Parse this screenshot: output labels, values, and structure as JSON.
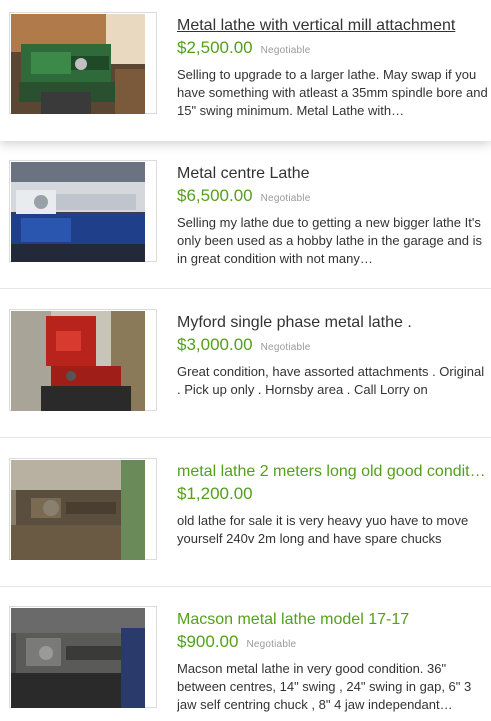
{
  "listings": [
    {
      "title": "Metal lathe with vertical mill attachment",
      "price": "$2,500.00",
      "negotiable": "Negotiable",
      "description": "Selling to upgrade to a larger lathe. May swap if you have something with atleast a 35mm spindle bore and 15\" swing minimum. Metal Lathe with…",
      "image_icon": "green-lathe-photo"
    },
    {
      "title": "Metal centre Lathe",
      "price": "$6,500.00",
      "negotiable": "Negotiable",
      "description": "Selling my lathe due to getting a new bigger lathe It's only been used as a hobby lathe in the garage and is in great condition with not many…",
      "image_icon": "blue-lathe-photo"
    },
    {
      "title": "Myford single phase metal lathe .",
      "price": "$3,000.00",
      "negotiable": "Negotiable",
      "description": "Great condition, have assorted attachments . Original . Pick up only . Hornsby area . Call Lorry on",
      "image_icon": "red-lathe-photo"
    },
    {
      "title": "metal lathe 2 meters long old good conditi…",
      "price": "$1,200.00",
      "negotiable": "",
      "description": "old lathe for sale it is very heavy yuo have to move yourself 240v 2m long and have spare chucks",
      "image_icon": "old-lathe-photo"
    },
    {
      "title": "Macson metal lathe model 17-17",
      "price": "$900.00",
      "negotiable": "Negotiable",
      "description": "Macson metal lathe in very good condition. 36\" between centres, 14\" swing , 24\" swing in gap, 6\" 3 jaw self centring chuck , 8\" 4 jaw independant…",
      "image_icon": "grey-lathe-photo"
    }
  ],
  "colors": {
    "price_green": "#54a01b",
    "link_green": "#54a01b",
    "text": "#333333",
    "muted": "#9a9a9a"
  }
}
